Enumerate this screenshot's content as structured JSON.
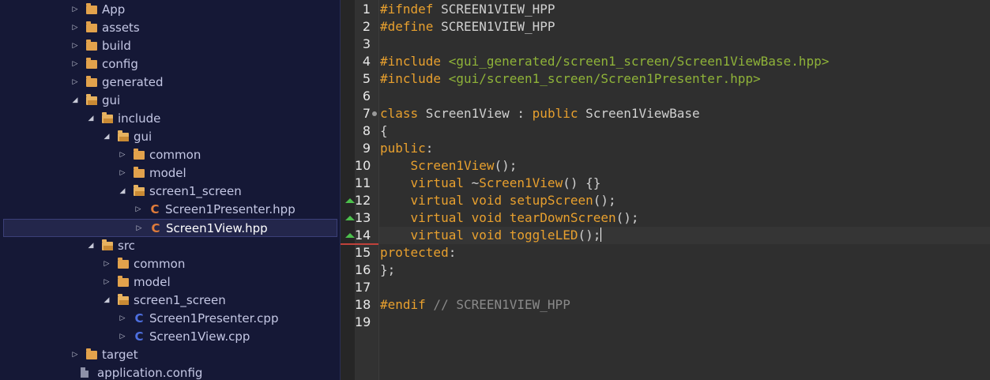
{
  "explorer": {
    "items": [
      {
        "label": "App",
        "kind": "folder",
        "state": "collapsed",
        "depth": 0
      },
      {
        "label": "assets",
        "kind": "folder",
        "state": "collapsed",
        "depth": 0
      },
      {
        "label": "build",
        "kind": "folder",
        "state": "collapsed",
        "depth": 0
      },
      {
        "label": "config",
        "kind": "folder",
        "state": "collapsed",
        "depth": 0
      },
      {
        "label": "generated",
        "kind": "folder",
        "state": "collapsed",
        "depth": 0
      },
      {
        "label": "gui",
        "kind": "folder",
        "state": "expanded",
        "depth": 0
      },
      {
        "label": "include",
        "kind": "folder",
        "state": "expanded",
        "depth": 1
      },
      {
        "label": "gui",
        "kind": "folder",
        "state": "expanded",
        "depth": 2
      },
      {
        "label": "common",
        "kind": "folder",
        "state": "collapsed",
        "depth": 3
      },
      {
        "label": "model",
        "kind": "folder",
        "state": "collapsed",
        "depth": 3
      },
      {
        "label": "screen1_screen",
        "kind": "folder",
        "state": "expanded",
        "depth": 3
      },
      {
        "label": "Screen1Presenter.hpp",
        "kind": "c-header",
        "state": "collapsed",
        "depth": 4
      },
      {
        "label": "Screen1View.hpp",
        "kind": "c-header",
        "state": "collapsed",
        "depth": 4,
        "selected": true
      },
      {
        "label": "src",
        "kind": "folder",
        "state": "expanded",
        "depth": 1
      },
      {
        "label": "common",
        "kind": "folder",
        "state": "collapsed",
        "depth": 2
      },
      {
        "label": "model",
        "kind": "folder",
        "state": "collapsed",
        "depth": 2
      },
      {
        "label": "screen1_screen",
        "kind": "folder",
        "state": "expanded",
        "depth": 2
      },
      {
        "label": "Screen1Presenter.cpp",
        "kind": "c-source",
        "state": "collapsed",
        "depth": 3
      },
      {
        "label": "Screen1View.cpp",
        "kind": "c-source",
        "state": "collapsed",
        "depth": 3
      },
      {
        "label": "target",
        "kind": "folder",
        "state": "collapsed",
        "depth": 0
      },
      {
        "label": "application.config",
        "kind": "file",
        "state": "none",
        "depth": 0
      }
    ]
  },
  "editor": {
    "current_line": 14,
    "changed_lines": [
      12,
      13,
      14
    ],
    "fold_line": 7,
    "lines": [
      {
        "n": "1",
        "tokens": [
          {
            "t": "#ifndef",
            "c": "kw"
          },
          {
            "t": " SCREEN1VIEW_HPP",
            "c": "plain"
          }
        ]
      },
      {
        "n": "2",
        "tokens": [
          {
            "t": "#define",
            "c": "kw"
          },
          {
            "t": " SCREEN1VIEW_HPP",
            "c": "plain"
          }
        ]
      },
      {
        "n": "3",
        "tokens": []
      },
      {
        "n": "4",
        "tokens": [
          {
            "t": "#include",
            "c": "kw"
          },
          {
            "t": " <gui_generated/screen1_screen/Screen1ViewBase.hpp>",
            "c": "inc"
          }
        ]
      },
      {
        "n": "5",
        "tokens": [
          {
            "t": "#include",
            "c": "kw"
          },
          {
            "t": " <gui/screen1_screen/Screen1Presenter.hpp>",
            "c": "inc"
          }
        ]
      },
      {
        "n": "6",
        "tokens": []
      },
      {
        "n": "7",
        "tokens": [
          {
            "t": "class",
            "c": "kw"
          },
          {
            "t": " Screen1View : ",
            "c": "plain"
          },
          {
            "t": "public",
            "c": "kw"
          },
          {
            "t": " Screen1ViewBase",
            "c": "plain"
          }
        ]
      },
      {
        "n": "8",
        "tokens": [
          {
            "t": "{",
            "c": "plain"
          }
        ]
      },
      {
        "n": "9",
        "tokens": [
          {
            "t": "public",
            "c": "kw"
          },
          {
            "t": ":",
            "c": "plain"
          }
        ]
      },
      {
        "n": "10",
        "tokens": [
          {
            "t": "    ",
            "c": "plain"
          },
          {
            "t": "Screen1View",
            "c": "fn"
          },
          {
            "t": "();",
            "c": "plain"
          }
        ]
      },
      {
        "n": "11",
        "tokens": [
          {
            "t": "    ",
            "c": "plain"
          },
          {
            "t": "virtual",
            "c": "kw"
          },
          {
            "t": " ~",
            "c": "plain"
          },
          {
            "t": "Screen1View",
            "c": "fn"
          },
          {
            "t": "() {}",
            "c": "plain"
          }
        ]
      },
      {
        "n": "12",
        "tokens": [
          {
            "t": "    ",
            "c": "plain"
          },
          {
            "t": "virtual void",
            "c": "kw"
          },
          {
            "t": " ",
            "c": "plain"
          },
          {
            "t": "setupScreen",
            "c": "fn"
          },
          {
            "t": "();",
            "c": "plain"
          }
        ]
      },
      {
        "n": "13",
        "tokens": [
          {
            "t": "    ",
            "c": "plain"
          },
          {
            "t": "virtual void",
            "c": "kw"
          },
          {
            "t": " ",
            "c": "plain"
          },
          {
            "t": "tearDownScreen",
            "c": "fn"
          },
          {
            "t": "();",
            "c": "plain"
          }
        ]
      },
      {
        "n": "14",
        "tokens": [
          {
            "t": "    ",
            "c": "plain"
          },
          {
            "t": "virtual void",
            "c": "kw"
          },
          {
            "t": " ",
            "c": "plain"
          },
          {
            "t": "toggleLED",
            "c": "fn"
          },
          {
            "t": "();",
            "c": "plain"
          }
        ],
        "caret": true
      },
      {
        "n": "15",
        "tokens": [
          {
            "t": "protected",
            "c": "kw"
          },
          {
            "t": ":",
            "c": "plain"
          }
        ]
      },
      {
        "n": "16",
        "tokens": [
          {
            "t": "};",
            "c": "plain"
          }
        ]
      },
      {
        "n": "17",
        "tokens": []
      },
      {
        "n": "18",
        "tokens": [
          {
            "t": "#endif",
            "c": "kw"
          },
          {
            "t": " // SCREEN1VIEW_HPP",
            "c": "cmt"
          }
        ]
      },
      {
        "n": "19",
        "tokens": []
      }
    ]
  },
  "colors": {
    "explorer_bg": "#151836",
    "editor_bg": "#2f2f2f",
    "keyword": "#e8a02e",
    "include_path": "#8fb339",
    "comment": "#8a8a8a",
    "change_marker": "#4cc04c",
    "folder": "#e2a24c",
    "c_header_icon": "#e07c3a",
    "c_source_icon": "#4d6fe0"
  }
}
